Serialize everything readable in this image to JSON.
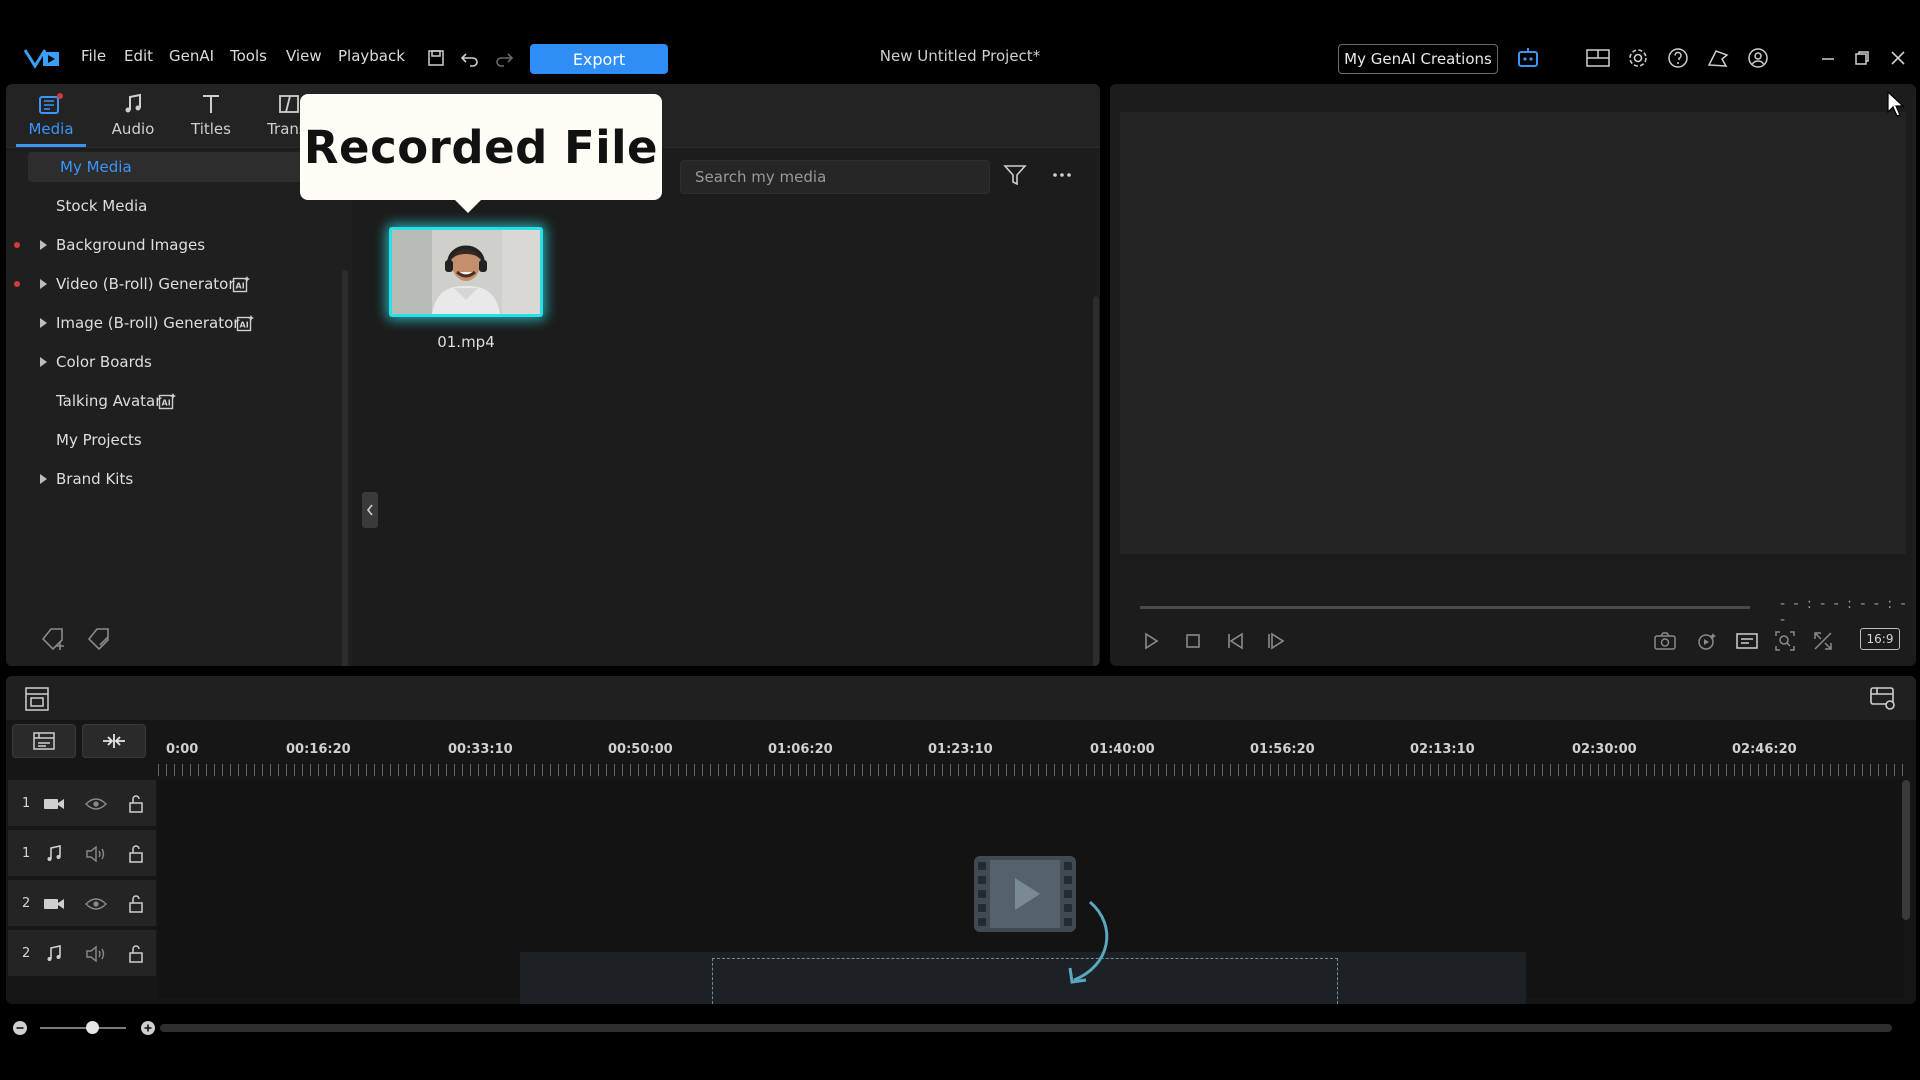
{
  "app": {
    "menu": [
      "File",
      "Edit",
      "GenAI",
      "Tools",
      "View",
      "Playback"
    ],
    "export_label": "Export",
    "project_title": "New Untitled Project*",
    "genai_creations_label": "My GenAI Creations"
  },
  "library": {
    "tabs": [
      {
        "label": "Media",
        "icon": "media-icon",
        "active": true
      },
      {
        "label": "Audio",
        "icon": "music-note-icon"
      },
      {
        "label": "Titles",
        "icon": "text-icon"
      },
      {
        "label": "Transi",
        "icon": "transition-icon"
      }
    ],
    "tree": [
      {
        "label": "My Media",
        "selected": true
      },
      {
        "label": "Stock Media"
      },
      {
        "label": "Background Images",
        "expandable": true,
        "dot": true
      },
      {
        "label": "Video (B-roll) Generator",
        "expandable": true,
        "dot": true,
        "ai_badge": true
      },
      {
        "label": "Image (B-roll) Generator",
        "expandable": true,
        "ai_badge": true
      },
      {
        "label": "Color Boards",
        "expandable": true
      },
      {
        "label": "Talking Avatar",
        "ai_badge": true
      },
      {
        "label": "My Projects"
      },
      {
        "label": "Brand Kits",
        "expandable": true
      }
    ],
    "search_placeholder": "Search my media",
    "media_items": [
      {
        "label": "01.mp4"
      }
    ],
    "callout_text": "Recorded File"
  },
  "preview": {
    "timecode": "- - : - - : - - : - -",
    "aspect_ratio": "16:9"
  },
  "timeline": {
    "ruler_labels": [
      "0:00",
      "00:16:20",
      "00:33:10",
      "00:50:00",
      "01:06:20",
      "01:23:10",
      "01:40:00",
      "01:56:20",
      "02:13:10",
      "02:30:00",
      "02:46:20"
    ],
    "tracks": [
      {
        "number": "1",
        "type": "video"
      },
      {
        "number": "1",
        "type": "audio"
      },
      {
        "number": "2",
        "type": "video"
      },
      {
        "number": "2",
        "type": "audio"
      }
    ]
  },
  "colors": {
    "accent": "#3a95f7",
    "highlight": "#27e0e8",
    "export": "#2f8ef6"
  }
}
